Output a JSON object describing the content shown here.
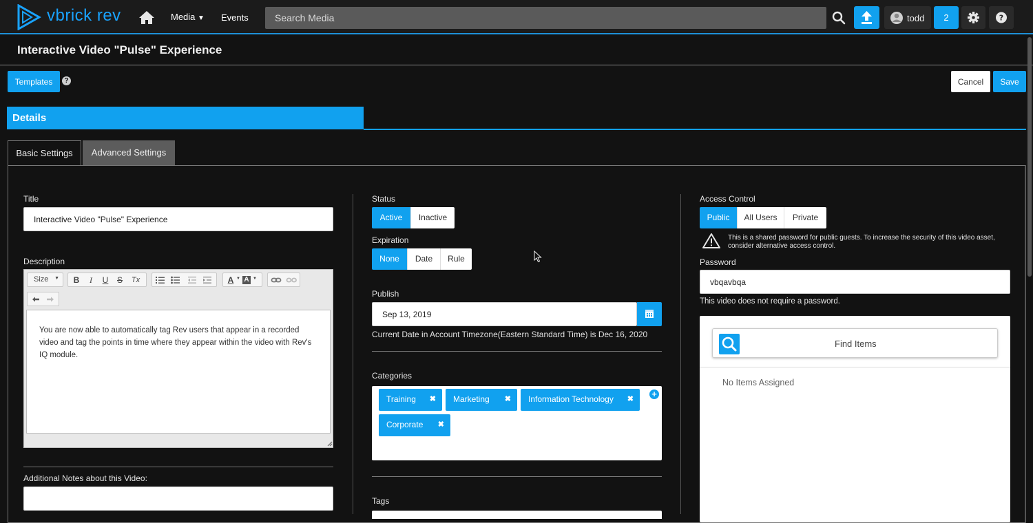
{
  "app": {
    "logo_text": "vbrick rev",
    "nav": {
      "media": "Media",
      "events": "Events"
    },
    "search_placeholder": "Search Media",
    "user": "todd",
    "notification_count": "2",
    "colors": {
      "accent": "#11a1ef",
      "background": "#121212"
    }
  },
  "page": {
    "title": "Interactive Video \"Pulse\" Experience",
    "templates_label": "Templates",
    "help_symbol": "?",
    "cancel_label": "Cancel",
    "save_label": "Save",
    "section_title": "Details",
    "tabs": [
      {
        "label": "Basic Settings",
        "active": true
      },
      {
        "label": "Advanced Settings",
        "active": false
      }
    ]
  },
  "form": {
    "title_label": "Title",
    "title_value": "Interactive Video \"Pulse\" Experience",
    "description_label": "Description",
    "editor_toolbar": {
      "size_label": "Size",
      "bold": "B",
      "italic": "I",
      "underline": "U",
      "strike": "S",
      "clear_format": "Tx",
      "font_color": "A",
      "bg_color": "A"
    },
    "description_value": "You are now able to automatically tag Rev users that appear in a recorded video and tag the points in time where they appear within the video with Rev's IQ module.",
    "notes_label": "Additional Notes about this Video:",
    "notes_value": "",
    "status_label": "Status",
    "status_options": [
      "Active",
      "Inactive"
    ],
    "status_selected": "Active",
    "expiration_label": "Expiration",
    "expiration_options": [
      "None",
      "Date",
      "Rule"
    ],
    "expiration_selected": "None",
    "publish_label": "Publish",
    "publish_value": "Sep 13, 2019",
    "current_date_text": "Current Date in Account Timezone(Eastern Standard Time) is Dec 16, 2020",
    "categories_label": "Categories",
    "categories": [
      "Training",
      "Marketing",
      "Information Technology",
      "Corporate"
    ],
    "tags_label": "Tags",
    "access_label": "Access Control",
    "access_options": [
      "Public",
      "All Users",
      "Private"
    ],
    "access_selected": "Public",
    "access_warning": "This is a shared password for public guests. To increase the security of this video asset, consider alternative access control.",
    "password_label": "Password",
    "password_value": "vbqavbqa",
    "password_note": "This video does not require a password.",
    "find_items_label": "Find Items",
    "no_items_text": "No Items Assigned"
  }
}
